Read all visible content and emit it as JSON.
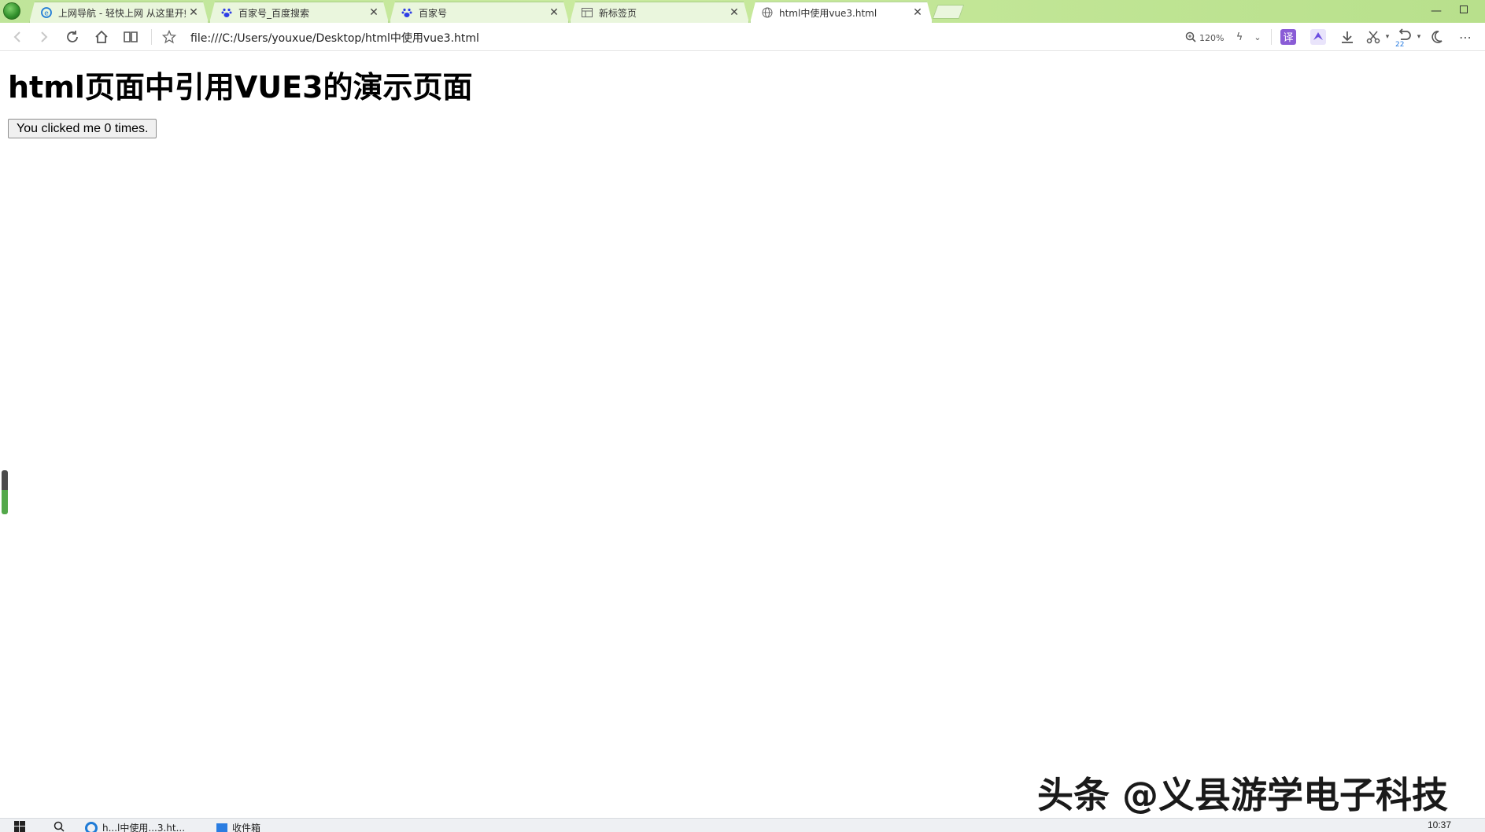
{
  "browser": {
    "tabs": [
      {
        "label": "上网导航 - 轻快上网 从这里开始",
        "icon": "ie-e-icon"
      },
      {
        "label": "百家号_百度搜索",
        "icon": "baidu-paw-icon"
      },
      {
        "label": "百家号",
        "icon": "baidu-paw-icon"
      },
      {
        "label": "新标签页",
        "icon": "grid-page-icon"
      },
      {
        "label": "html中使用vue3.html",
        "icon": "globe-icon",
        "active": true
      }
    ],
    "url": "file:///C:/Users/youxue/Desktop/html中使用vue3.html",
    "zoom": "120%",
    "undo_count": "22"
  },
  "page": {
    "title": "html页面中引用VUE3的演示页面",
    "button_label": "You clicked me 0 times."
  },
  "watermark": "头条 @义县游学电子科技",
  "taskbar": {
    "item1": "h...l中使用...3.ht...",
    "item2": "收件箱",
    "clock": "10:37"
  },
  "colors": {
    "tabbar_bg": "#c3e797",
    "accent_purple": "#8a5cd6",
    "progress_green": "#53a84a"
  }
}
